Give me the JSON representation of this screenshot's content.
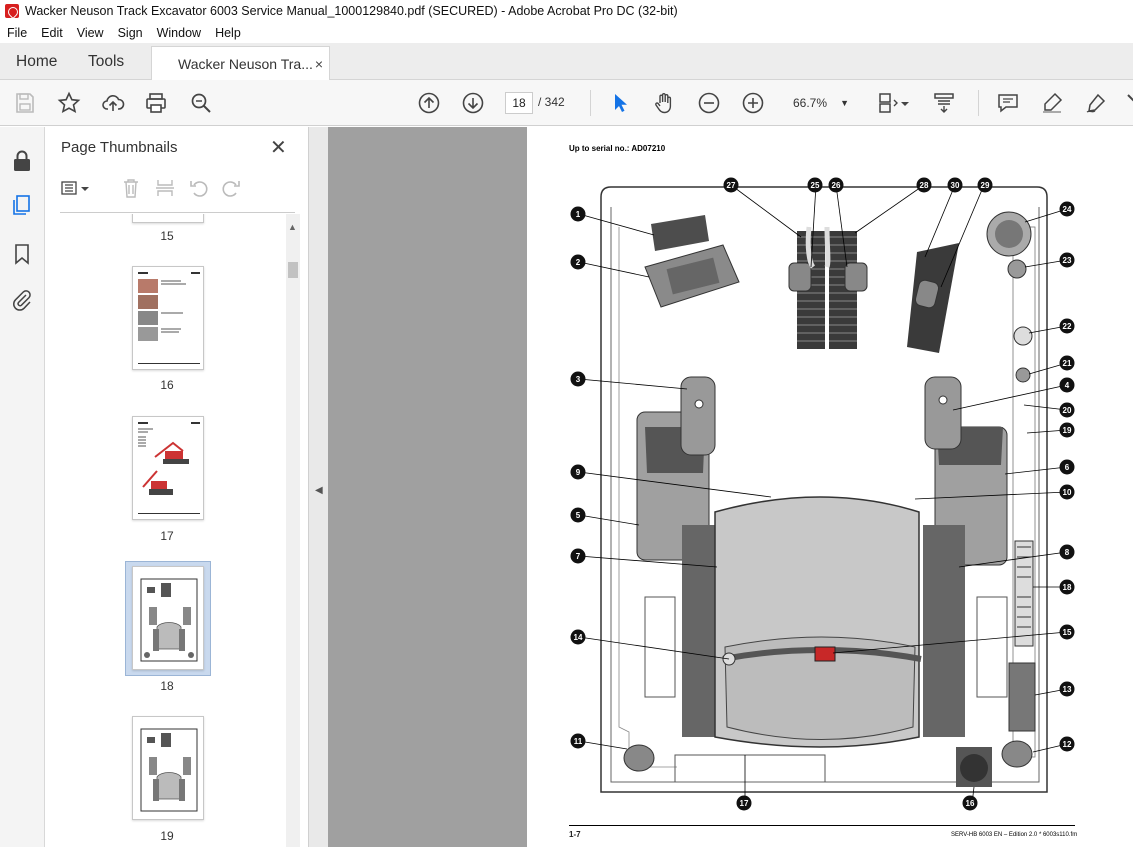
{
  "window": {
    "title": "Wacker Neuson Track Excavator 6003 Service Manual_1000129840.pdf (SECURED) - Adobe Acrobat Pro DC (32-bit)"
  },
  "menu": [
    "File",
    "Edit",
    "View",
    "Sign",
    "Window",
    "Help"
  ],
  "tabs": {
    "home": "Home",
    "tools": "Tools",
    "document": "Wacker Neuson Tra...",
    "close_glyph": "×"
  },
  "toolbar": {
    "current_page": "18",
    "page_total": "/ 342",
    "zoom": "66.7%"
  },
  "thumbnails_panel": {
    "title": "Page Thumbnails",
    "close_glyph": "✕",
    "pages": [
      {
        "label": "15"
      },
      {
        "label": "16"
      },
      {
        "label": "17"
      },
      {
        "label": "18",
        "selected": true
      },
      {
        "label": "19"
      }
    ]
  },
  "document_page": {
    "header": "Up to serial no.: AD07210",
    "footer_left": "1-7",
    "footer_right": "SERV-HB 6003 EN – Edition 2.0 * 6003s110.fm",
    "callouts": [
      "1",
      "2",
      "3",
      "4",
      "5",
      "6",
      "7",
      "8",
      "9",
      "10",
      "11",
      "12",
      "13",
      "14",
      "15",
      "16",
      "17",
      "18",
      "19",
      "20",
      "21",
      "22",
      "23",
      "24",
      "25",
      "26",
      "27",
      "28",
      "29",
      "30"
    ]
  },
  "colors": {
    "accent_blue": "#1473e6",
    "canvas_gray": "#a0a0a0",
    "acrobat_red": "#d71f1f"
  }
}
